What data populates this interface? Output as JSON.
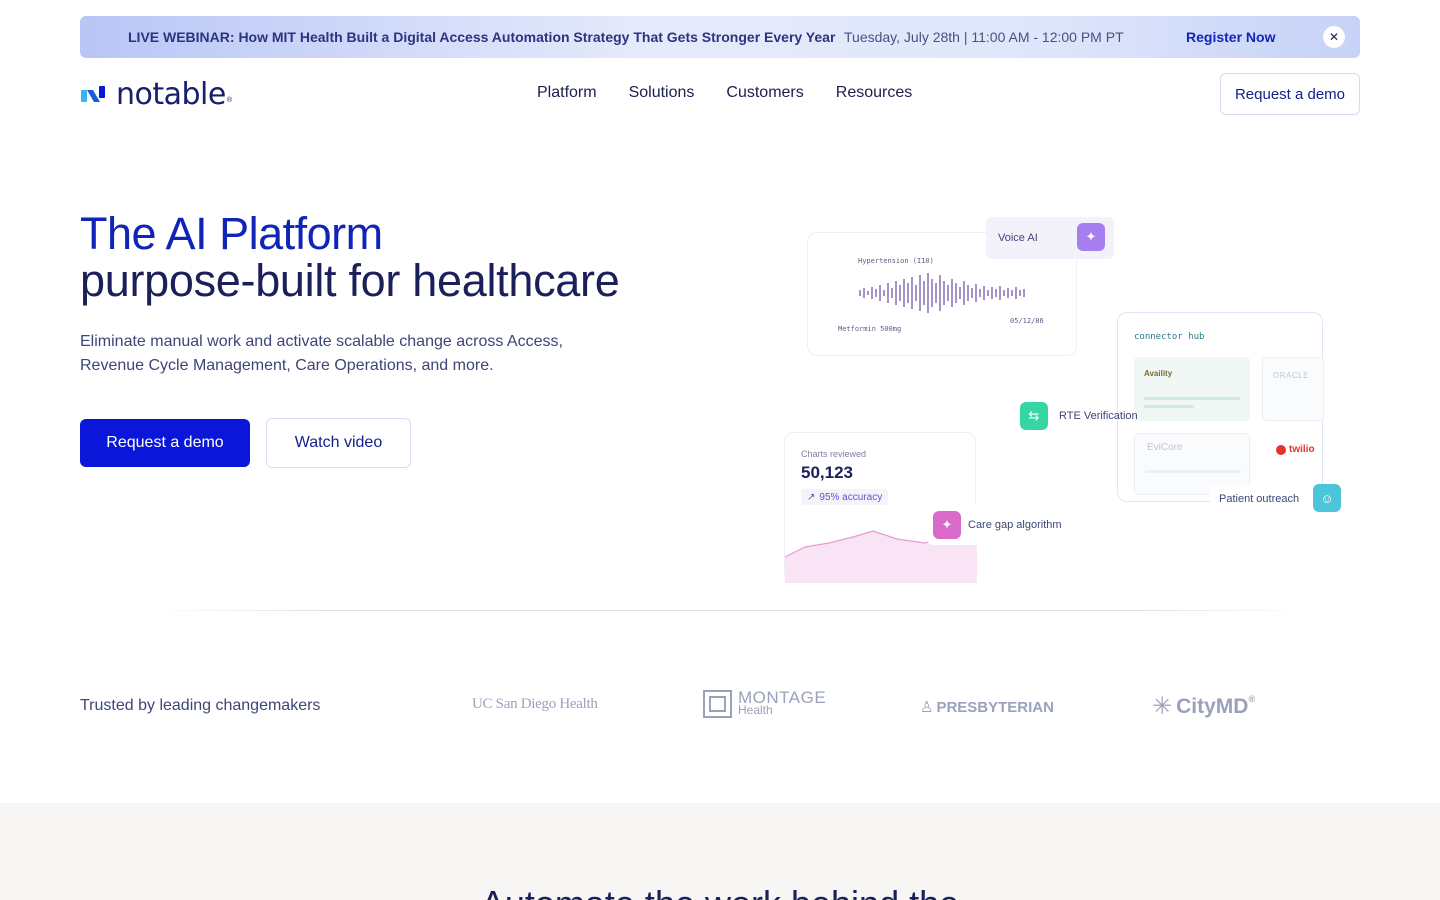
{
  "banner": {
    "title": "LIVE WEBINAR: How MIT Health Built a Digital Access Automation Strategy That Gets Stronger Every Year",
    "date": "Tuesday, July 28th | 11:00 AM - 12:00 PM PT",
    "register_label": "Register Now",
    "close_glyph": "✕"
  },
  "header": {
    "logo_text": "notable",
    "logo_reg": "®",
    "nav": [
      "Platform",
      "Solutions",
      "Customers",
      "Resources"
    ],
    "demo_label": "Request a demo"
  },
  "hero": {
    "title_line1": "The AI Platform",
    "title_line2": "purpose-built for healthcare",
    "subtitle": "Eliminate manual work and activate scalable change across Access, Revenue Cycle Management, Care Operations, and more.",
    "primary_cta": "Request a demo",
    "secondary_cta": "Watch video"
  },
  "illustration": {
    "voice_ai_label": "Voice AI",
    "hypertension": "Hypertension (I10)",
    "metformin": "Metformin 500mg",
    "voice_date": "05/12/86",
    "connector_hub": "connector hub",
    "availity": "Availity",
    "oracle": "ORACLE",
    "evicore": "EviCore",
    "twilio": "twilio",
    "rte_label": "RTE Verification",
    "charts_reviewed_label": "Charts reviewed",
    "charts_reviewed_value": "50,123",
    "accuracy": "95% accuracy",
    "care_gap_label": "Care gap algorithm",
    "patient_outreach_label": "Patient outreach"
  },
  "trusted": {
    "label": "Trusted by leading changemakers",
    "logos": {
      "ucsd": "UC San Diego Health",
      "montage_top": "MONTAGE",
      "montage_bottom": "Health",
      "presbyterian": "PRESBYTERIAN",
      "citymd": "CityMD",
      "citymd_reg": "®"
    }
  },
  "next_section": {
    "heading": "Automate the work behind the"
  },
  "colors": {
    "brand_blue": "#0a17d9",
    "navy": "#1b1f5a",
    "accent_purple": "#9b6cf0",
    "accent_green": "#35d6a4",
    "accent_pink": "#d96ac9",
    "accent_teal": "#4cc4d9"
  }
}
